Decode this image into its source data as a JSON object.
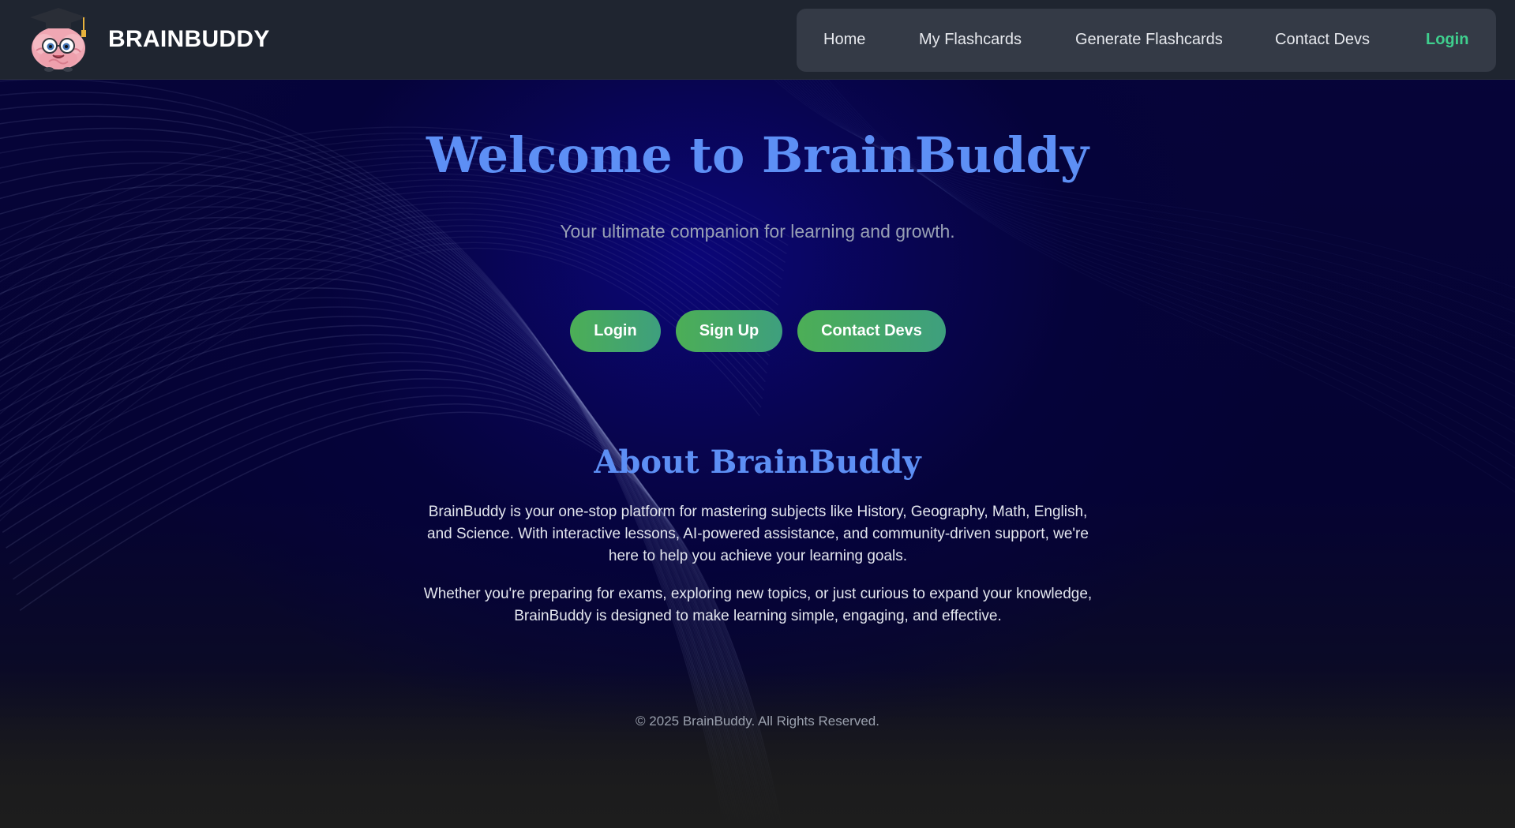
{
  "navbar": {
    "brand": "BRAINBUDDY",
    "logo_icon": "brain-mascot-graduation-cap",
    "links": [
      {
        "label": "Home"
      },
      {
        "label": "My Flashcards"
      },
      {
        "label": "Generate Flashcards"
      },
      {
        "label": "Contact Devs"
      },
      {
        "label": "Login"
      }
    ]
  },
  "hero": {
    "title": "Welcome to BrainBuddy",
    "subtitle": "Your ultimate companion for learning and growth.",
    "buttons": [
      {
        "label": "Login"
      },
      {
        "label": "Sign Up"
      },
      {
        "label": "Contact Devs"
      }
    ]
  },
  "about": {
    "title": "About BrainBuddy",
    "paragraph1": "BrainBuddy is your one-stop platform for mastering subjects like History, Geography, Math, English, and Science. With interactive lessons, AI-powered assistance, and community-driven support, we're here to help you achieve your learning goals.",
    "paragraph2": "Whether you're preparing for exams, exploring new topics, or just curious to expand your knowledge, BrainBuddy is designed to make learning simple, engaging, and effective."
  },
  "footer": {
    "text": "© 2025 BrainBuddy. All Rights Reserved."
  },
  "colors": {
    "accent_blue": "#5d8ff5",
    "button_green": "#4cae56",
    "login_green": "#3fcf8e",
    "navbar_bg": "#1f2530"
  }
}
